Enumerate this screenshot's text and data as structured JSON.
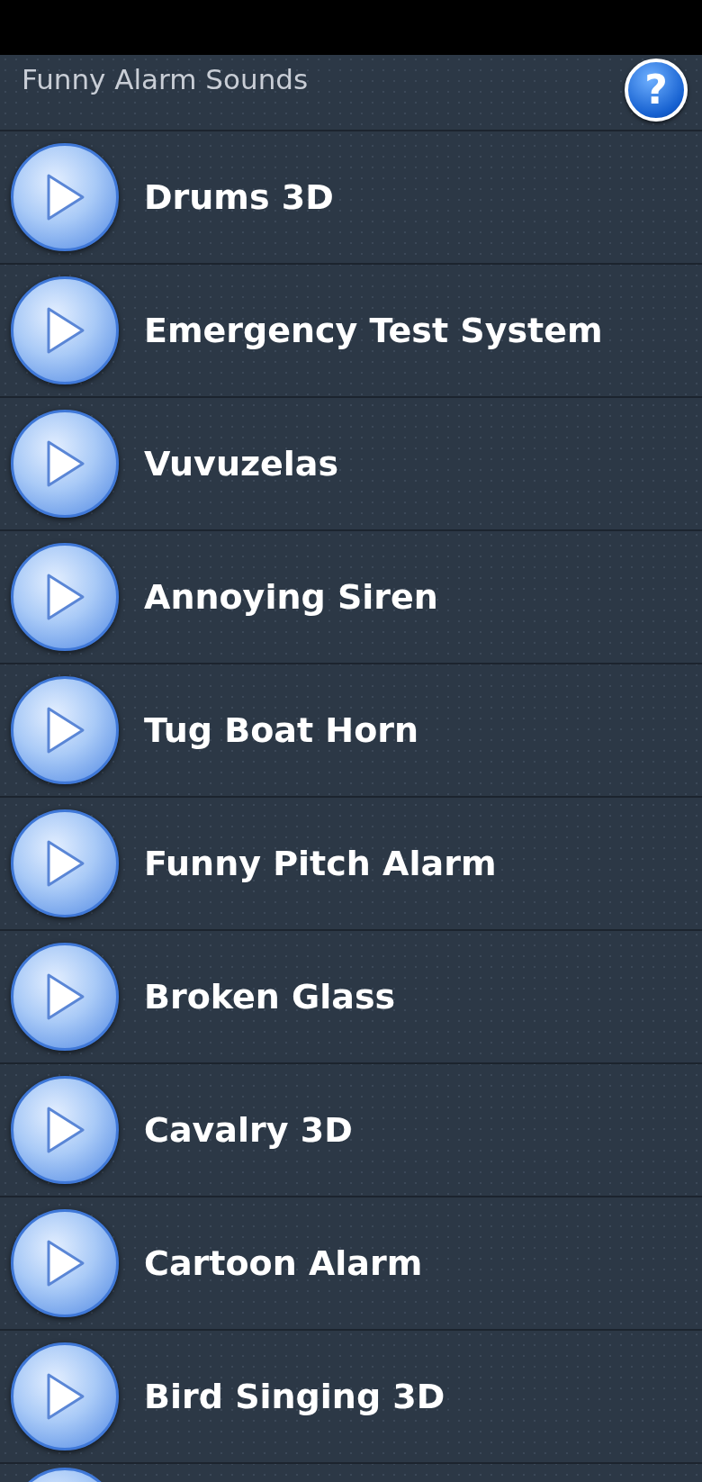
{
  "header": {
    "title": "Funny Alarm Sounds",
    "help_button": "?"
  },
  "sounds": [
    {
      "name": "Drums 3D"
    },
    {
      "name": "Emergency Test System"
    },
    {
      "name": "Vuvuzelas"
    },
    {
      "name": "Annoying Siren"
    },
    {
      "name": "Tug Boat Horn"
    },
    {
      "name": "Funny Pitch Alarm"
    },
    {
      "name": "Broken Glass"
    },
    {
      "name": "Cavalry 3D"
    },
    {
      "name": "Cartoon Alarm"
    },
    {
      "name": "Bird Singing 3D"
    }
  ]
}
